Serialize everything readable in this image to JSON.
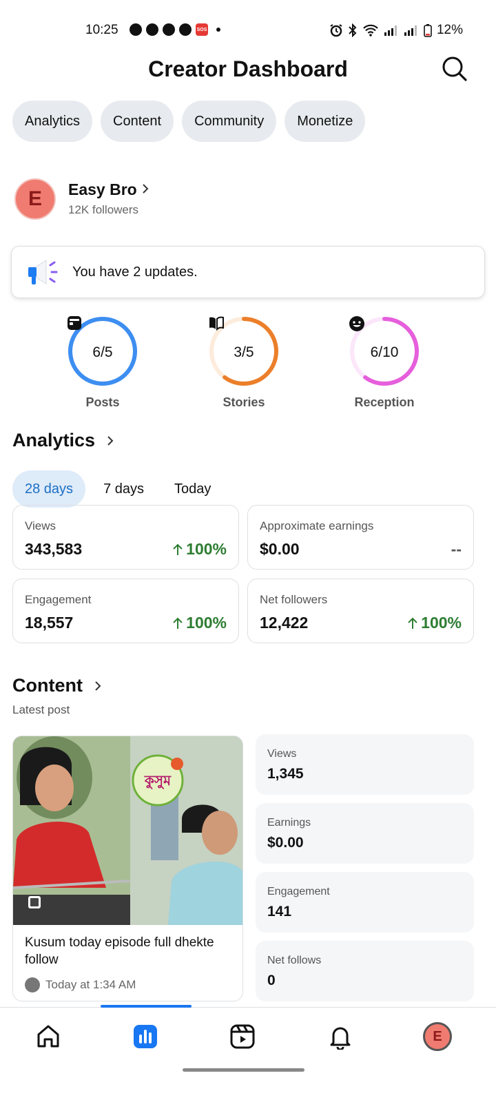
{
  "status_bar": {
    "time": "10:25",
    "battery": "12%",
    "sos_label": "SOS",
    "icons": [
      "telegram-icon",
      "telegram-icon",
      "telegram-icon",
      "messenger-icon",
      "sos-icon",
      "notification-dot",
      "alarm-icon",
      "bluetooth-icon",
      "wifi-icon",
      "signal-icon",
      "signal-icon",
      "battery-icon"
    ]
  },
  "header": {
    "title": "Creator Dashboard",
    "search_icon": "search-icon"
  },
  "tabs": [
    {
      "label": "Analytics"
    },
    {
      "label": "Content"
    },
    {
      "label": "Community"
    },
    {
      "label": "Monetize"
    }
  ],
  "profile": {
    "initial": "E",
    "name": "Easy Bro",
    "followers": "12K followers"
  },
  "updates": {
    "text": "You have 2 updates.",
    "icon": "megaphone-icon"
  },
  "rings": [
    {
      "label": "Posts",
      "value": "6/5",
      "progress": 1.0,
      "color": "#3d8ef0",
      "track": "#3d8ef0",
      "icon": "posts-icon"
    },
    {
      "label": "Stories",
      "value": "3/5",
      "progress": 0.6,
      "color": "#ec7f2a",
      "track": "#fdebdc",
      "icon": "book-icon"
    },
    {
      "label": "Reception",
      "value": "6/10",
      "progress": 0.6,
      "color": "#e65fdc",
      "track": "#fbe6fa",
      "icon": "smiley-icon"
    }
  ],
  "analytics": {
    "title": "Analytics",
    "ranges": [
      {
        "label": "28 days",
        "active": true
      },
      {
        "label": "7 days",
        "active": false
      },
      {
        "label": "Today",
        "active": false
      }
    ],
    "stats": [
      {
        "label": "Views",
        "value": "343,583",
        "change": "100%",
        "trend": "up"
      },
      {
        "label": "Approximate earnings",
        "value": "$0.00",
        "change": "--",
        "trend": "none"
      },
      {
        "label": "Engagement",
        "value": "18,557",
        "change": "100%",
        "trend": "up"
      },
      {
        "label": "Net followers",
        "value": "12,422",
        "change": "100%",
        "trend": "up"
      }
    ]
  },
  "content": {
    "title": "Content",
    "subtitle": "Latest post",
    "post": {
      "caption": "Kusum today episode full dhekte follow",
      "time": "Today at 1:34 AM",
      "thumb_logo_text": "কুসুম"
    },
    "metrics": [
      {
        "label": "Views",
        "value": "1,345"
      },
      {
        "label": "Earnings",
        "value": "$0.00"
      },
      {
        "label": "Engagement",
        "value": "141"
      },
      {
        "label": "Net follows",
        "value": "0"
      }
    ]
  },
  "bottom_nav": {
    "items": [
      "home-icon",
      "insights-icon",
      "reels-icon",
      "bell-icon",
      "profile-avatar"
    ],
    "active": "insights-icon",
    "avatar_initial": "E"
  }
}
